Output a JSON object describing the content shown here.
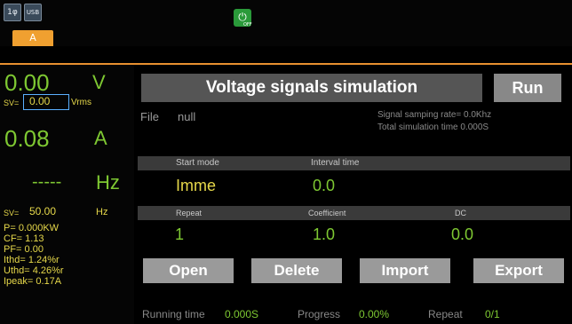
{
  "top_bar": {
    "icon1_label": "1φ",
    "icon2_label": "USB",
    "tab_label": "A",
    "power_label": "OFF"
  },
  "left_panel": {
    "voltage": "0.00",
    "voltage_unit": "V",
    "sv_label": "SV=",
    "sv_voltage": "0.00",
    "vrms_unit": "Vrms",
    "current": "0.08",
    "current_unit": "A",
    "frequency": "-----",
    "frequency_unit": "Hz",
    "sv_frequency": "50.00",
    "sv_frequency_unit": "Hz",
    "metrics": [
      "P= 0.000KW",
      "CF= 1.13",
      "PF= 0.00",
      "Ithd= 1.24%r",
      "Uthd= 4.26%r",
      "Ipeak= 0.17A"
    ]
  },
  "main": {
    "title": "Voltage signals simulation",
    "run_button": "Run",
    "file_label": "File",
    "file_value": "null",
    "signal_rate": "Signal samping rate= 0.0Khz",
    "total_time": "Total simulation time 0.000S",
    "start_mode_label": "Start mode",
    "interval_label": "Interval time",
    "start_mode_value": "Imme",
    "interval_value": "0.0",
    "repeat_label": "Repeat",
    "coefficient_label": "Coefficient",
    "dc_label": "DC",
    "repeat_value": "1",
    "coefficient_value": "1.0",
    "dc_value": "0.0",
    "buttons": {
      "open": "Open",
      "delete": "Delete",
      "import": "Import",
      "export": "Export"
    },
    "status": {
      "running_time_label": "Running time",
      "running_time_value": "0.000S",
      "progress_label": "Progress",
      "progress_value": "0.00%",
      "repeat_label": "Repeat",
      "repeat_value": "0/1"
    }
  },
  "colors": {
    "accent_orange": "#e89030",
    "measure_green": "#7ec832",
    "setting_yellow": "#e6d84a",
    "button_gray": "#9a9a9a"
  }
}
